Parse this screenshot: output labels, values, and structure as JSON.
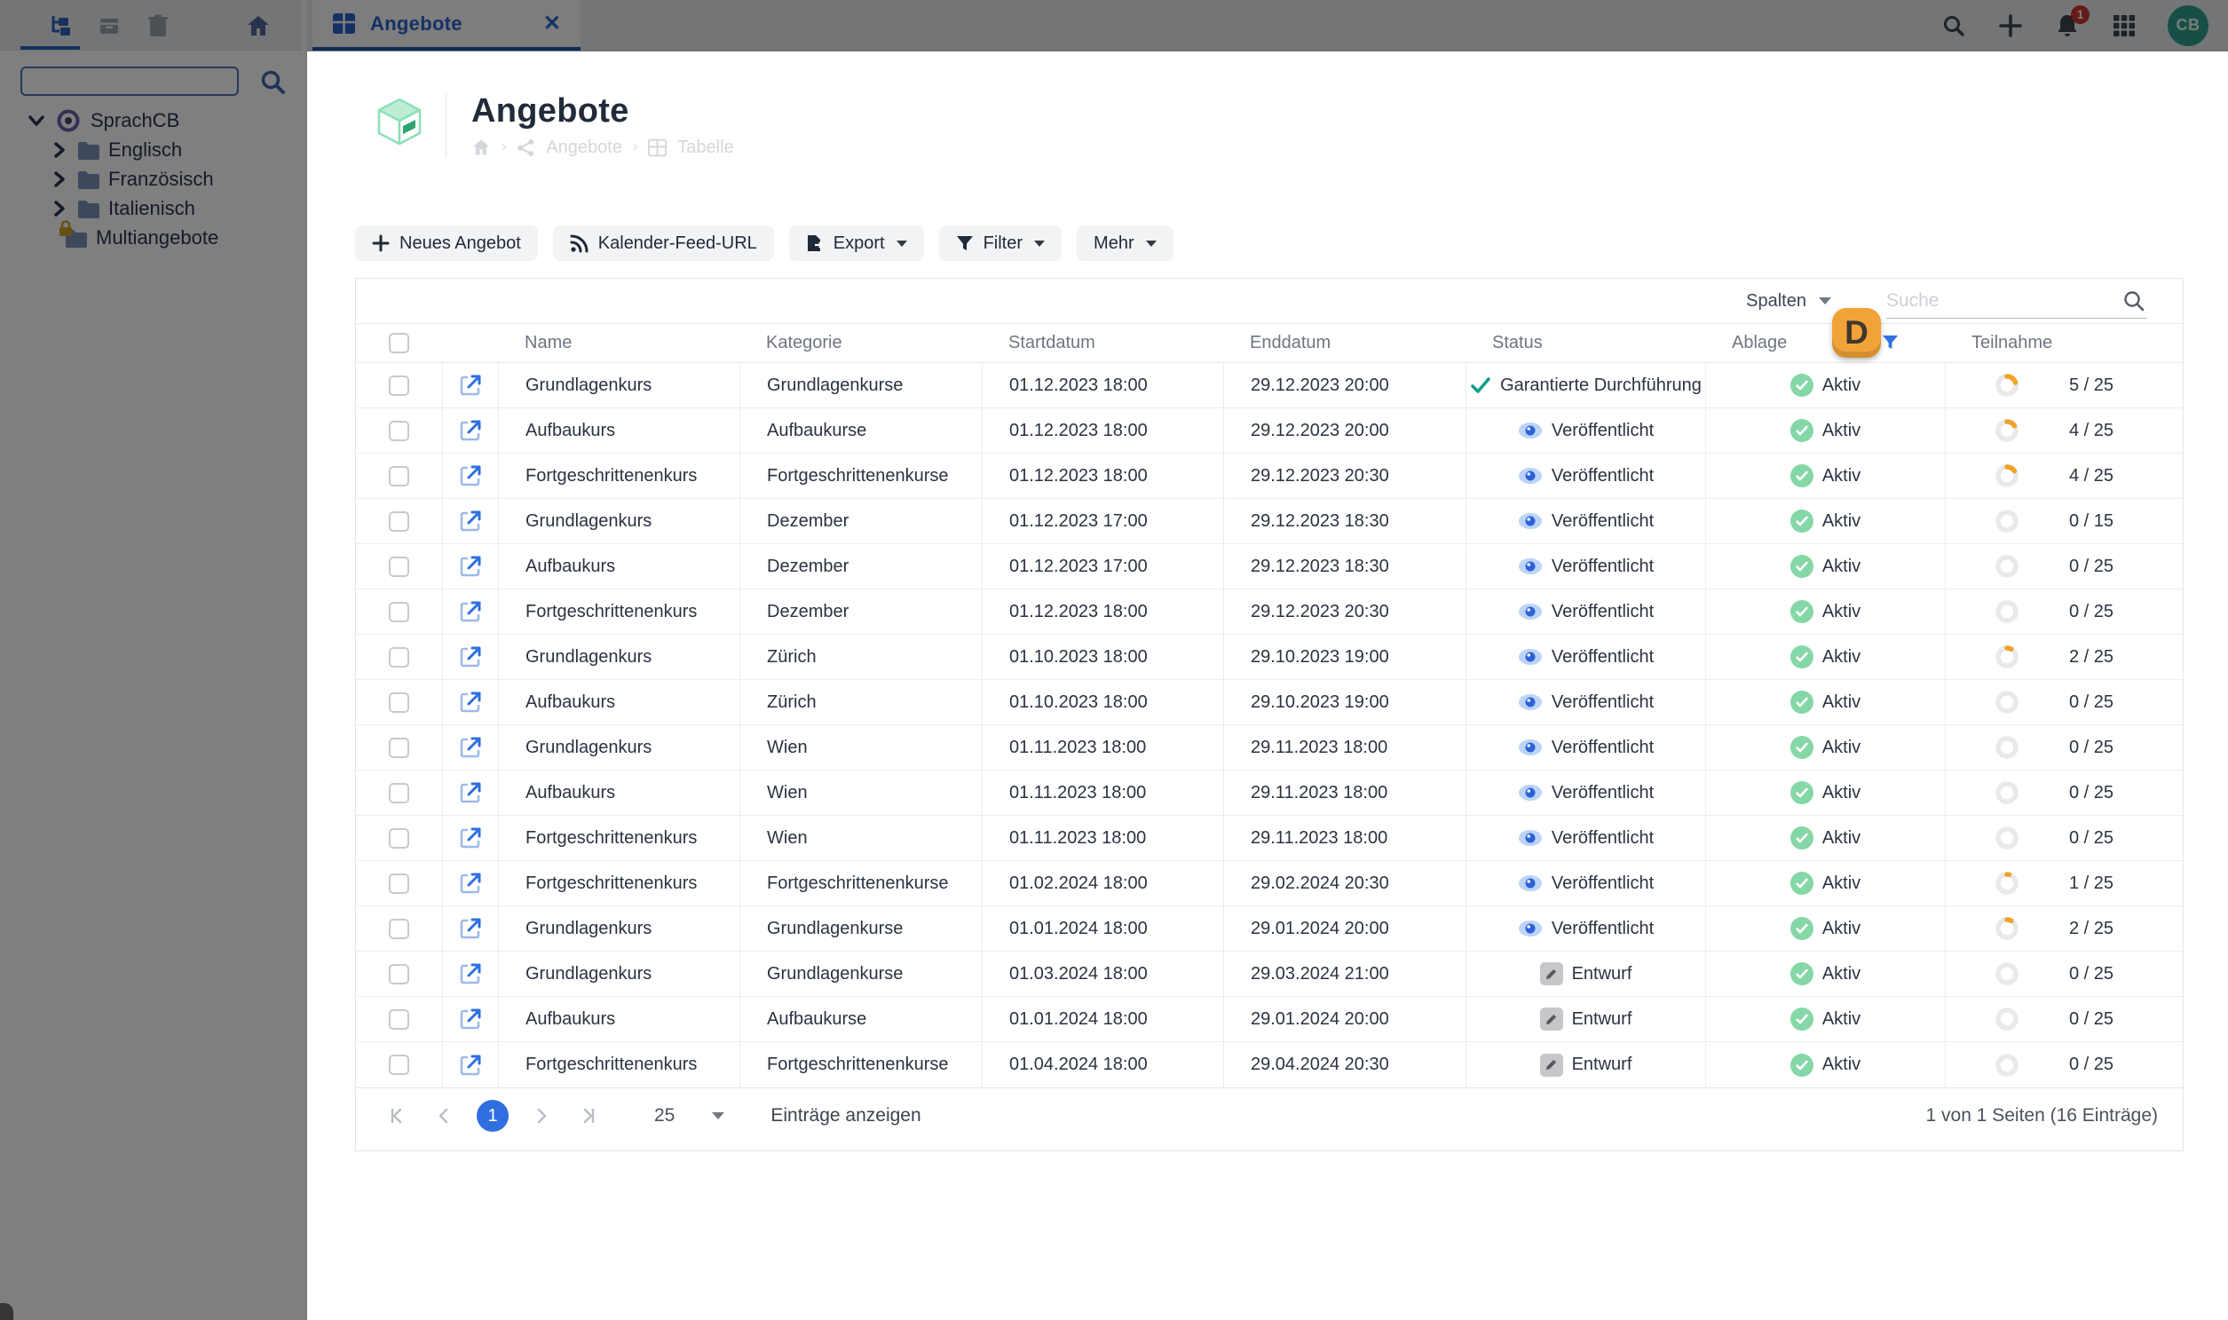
{
  "topbar": {
    "tab": {
      "label": "Angebote"
    },
    "notification_count": "1",
    "avatar_initials": "CB",
    "icons": [
      "tree-icon",
      "box-icon",
      "trash-icon",
      "home-icon",
      "search-icon",
      "plus-icon",
      "bell-icon",
      "apps-grid-icon",
      "avatar"
    ]
  },
  "sidebar": {
    "search_placeholder": "",
    "tree": {
      "root": "SprachCB",
      "children": [
        {
          "label": "Englisch",
          "locked": false
        },
        {
          "label": "Französisch",
          "locked": false
        },
        {
          "label": "Italienisch",
          "locked": false
        },
        {
          "label": "Multiangebote",
          "locked": true
        }
      ]
    }
  },
  "page": {
    "title": "Angebote",
    "breadcrumb": {
      "items": [
        "Angebote",
        "Tabelle"
      ]
    }
  },
  "actions": [
    {
      "label": "Neues Angebot",
      "icon": "plus-icon",
      "caret": false
    },
    {
      "label": "Kalender-Feed-URL",
      "icon": "rss-icon",
      "caret": false
    },
    {
      "label": "Export",
      "icon": "file-export-icon",
      "caret": true
    },
    {
      "label": "Filter",
      "icon": "funnel-icon",
      "caret": true
    },
    {
      "label": "Mehr",
      "icon": "",
      "caret": true
    }
  ],
  "table": {
    "toolbar": {
      "columns_label": "Spalten",
      "search_placeholder": "Suche"
    },
    "columns": [
      "",
      "",
      "Name",
      "Kategorie",
      "Startdatum",
      "Enddatum",
      "Status",
      "Ablage",
      "Teilnahme"
    ],
    "filtered_column": "Ablage",
    "rows": [
      {
        "name": "Grundlagenkurs",
        "kategorie": "Grundlagenkurse",
        "start": "01.12.2023 18:00",
        "ende": "29.12.2023 20:00",
        "status_type": "garantiert",
        "status": "Garantierte Durchführung",
        "ablage": "Aktiv",
        "teil_current": 5,
        "teil_total": 25,
        "teil_label": "5 / 25"
      },
      {
        "name": "Aufbaukurs",
        "kategorie": "Aufbaukurse",
        "start": "01.12.2023 18:00",
        "ende": "29.12.2023 20:00",
        "status_type": "veroeffentlicht",
        "status": "Veröffentlicht",
        "ablage": "Aktiv",
        "teil_current": 4,
        "teil_total": 25,
        "teil_label": "4 / 25"
      },
      {
        "name": "Fortgeschrittenenkurs",
        "kategorie": "Fortgeschrittenenkurse",
        "start": "01.12.2023 18:00",
        "ende": "29.12.2023 20:30",
        "status_type": "veroeffentlicht",
        "status": "Veröffentlicht",
        "ablage": "Aktiv",
        "teil_current": 4,
        "teil_total": 25,
        "teil_label": "4 / 25"
      },
      {
        "name": "Grundlagenkurs",
        "kategorie": "Dezember",
        "start": "01.12.2023 17:00",
        "ende": "29.12.2023 18:30",
        "status_type": "veroeffentlicht",
        "status": "Veröffentlicht",
        "ablage": "Aktiv",
        "teil_current": 0,
        "teil_total": 15,
        "teil_label": "0 / 15"
      },
      {
        "name": "Aufbaukurs",
        "kategorie": "Dezember",
        "start": "01.12.2023 17:00",
        "ende": "29.12.2023 18:30",
        "status_type": "veroeffentlicht",
        "status": "Veröffentlicht",
        "ablage": "Aktiv",
        "teil_current": 0,
        "teil_total": 25,
        "teil_label": "0 / 25"
      },
      {
        "name": "Fortgeschrittenenkurs",
        "kategorie": "Dezember",
        "start": "01.12.2023 18:00",
        "ende": "29.12.2023 20:30",
        "status_type": "veroeffentlicht",
        "status": "Veröffentlicht",
        "ablage": "Aktiv",
        "teil_current": 0,
        "teil_total": 25,
        "teil_label": "0 / 25"
      },
      {
        "name": "Grundlagenkurs",
        "kategorie": "Zürich",
        "start": "01.10.2023 18:00",
        "ende": "29.10.2023 19:00",
        "status_type": "veroeffentlicht",
        "status": "Veröffentlicht",
        "ablage": "Aktiv",
        "teil_current": 2,
        "teil_total": 25,
        "teil_label": "2 / 25"
      },
      {
        "name": "Aufbaukurs",
        "kategorie": "Zürich",
        "start": "01.10.2023 18:00",
        "ende": "29.10.2023 19:00",
        "status_type": "veroeffentlicht",
        "status": "Veröffentlicht",
        "ablage": "Aktiv",
        "teil_current": 0,
        "teil_total": 25,
        "teil_label": "0 / 25"
      },
      {
        "name": "Grundlagenkurs",
        "kategorie": "Wien",
        "start": "01.11.2023 18:00",
        "ende": "29.11.2023 18:00",
        "status_type": "veroeffentlicht",
        "status": "Veröffentlicht",
        "ablage": "Aktiv",
        "teil_current": 0,
        "teil_total": 25,
        "teil_label": "0 / 25"
      },
      {
        "name": "Aufbaukurs",
        "kategorie": "Wien",
        "start": "01.11.2023 18:00",
        "ende": "29.11.2023 18:00",
        "status_type": "veroeffentlicht",
        "status": "Veröffentlicht",
        "ablage": "Aktiv",
        "teil_current": 0,
        "teil_total": 25,
        "teil_label": "0 / 25"
      },
      {
        "name": "Fortgeschrittenenkurs",
        "kategorie": "Wien",
        "start": "01.11.2023 18:00",
        "ende": "29.11.2023 18:00",
        "status_type": "veroeffentlicht",
        "status": "Veröffentlicht",
        "ablage": "Aktiv",
        "teil_current": 0,
        "teil_total": 25,
        "teil_label": "0 / 25"
      },
      {
        "name": "Fortgeschrittenenkurs",
        "kategorie": "Fortgeschrittenenkurse",
        "start": "01.02.2024 18:00",
        "ende": "29.02.2024 20:30",
        "status_type": "veroeffentlicht",
        "status": "Veröffentlicht",
        "ablage": "Aktiv",
        "teil_current": 1,
        "teil_total": 25,
        "teil_label": "1 / 25"
      },
      {
        "name": "Grundlagenkurs",
        "kategorie": "Grundlagenkurse",
        "start": "01.01.2024 18:00",
        "ende": "29.01.2024 20:00",
        "status_type": "veroeffentlicht",
        "status": "Veröffentlicht",
        "ablage": "Aktiv",
        "teil_current": 2,
        "teil_total": 25,
        "teil_label": "2 / 25"
      },
      {
        "name": "Grundlagenkurs",
        "kategorie": "Grundlagenkurse",
        "start": "01.03.2024 18:00",
        "ende": "29.03.2024 21:00",
        "status_type": "entwurf",
        "status": "Entwurf",
        "ablage": "Aktiv",
        "teil_current": 0,
        "teil_total": 25,
        "teil_label": "0 / 25"
      },
      {
        "name": "Aufbaukurs",
        "kategorie": "Aufbaukurse",
        "start": "01.01.2024 18:00",
        "ende": "29.01.2024 20:00",
        "status_type": "entwurf",
        "status": "Entwurf",
        "ablage": "Aktiv",
        "teil_current": 0,
        "teil_total": 25,
        "teil_label": "0 / 25"
      },
      {
        "name": "Fortgeschrittenenkurs",
        "kategorie": "Fortgeschrittenenkurse",
        "start": "01.04.2024 18:00",
        "ende": "29.04.2024 20:30",
        "status_type": "entwurf",
        "status": "Entwurf",
        "ablage": "Aktiv",
        "teil_current": 0,
        "teil_total": 25,
        "teil_label": "0 / 25"
      }
    ],
    "footer": {
      "current_page": "1",
      "page_size": "25",
      "entries_label": "Einträge anzeigen",
      "summary": "1 von 1 Seiten (16 Einträge)"
    }
  },
  "presence": {
    "label": "D"
  },
  "colors": {
    "accent_blue": "#2f6fe0",
    "tab_blue": "#2a62c9",
    "arc_orange": "#f0a32a",
    "presence_orange": "#f2a338",
    "status_green": "#85d7a7",
    "garantiert_teal": "#0f9d8f",
    "avatar_teal": "#2f9e8c",
    "notification_red": "#c8342c",
    "entwurf_gray": "#c7c7c9"
  }
}
